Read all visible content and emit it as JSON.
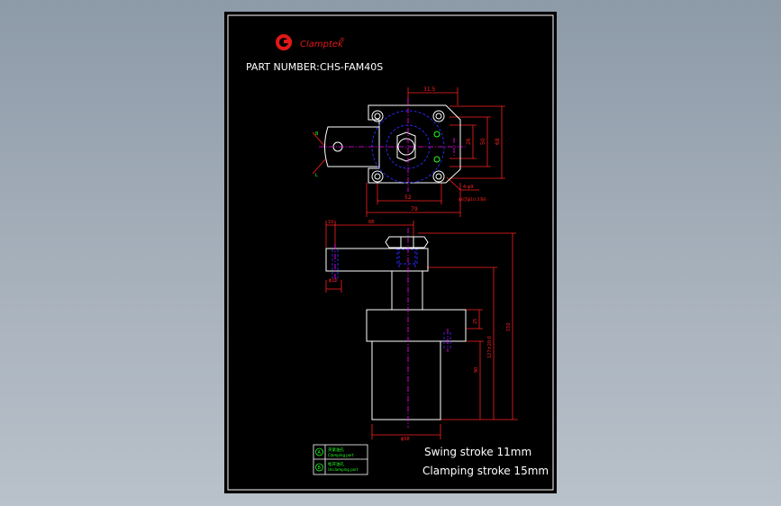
{
  "colors": {
    "background": "#000000",
    "outline": "#ffffff",
    "dimension": "#ff2020",
    "centerline": "#ff00ff",
    "hidden": "#2b2bff",
    "port_text": "#20ff20",
    "logo": "#e01818"
  },
  "title": {
    "brand": "Clamptek",
    "brand_mark": "®",
    "part_number_label": "PART NUMBER:",
    "part_number": "CHS-FAM40S"
  },
  "top_view": {
    "dims": {
      "overall_top": "31.5",
      "bottom_inner": "52",
      "bottom_overall": "79",
      "right_small": "26",
      "right_mid": "50",
      "right_large": "68"
    },
    "hole_note": "4-φ9",
    "thread_note": "ϕ6沉ϕ10.5深6",
    "side_markers": [
      "B",
      "L"
    ],
    "port_markers": [
      "A",
      "B"
    ]
  },
  "side_view": {
    "dims": {
      "top_left": "10",
      "top_arm": "68",
      "clamp_offset": "ϕ10",
      "right_small": "25",
      "right_mid": "127±20.0",
      "right_large": "150",
      "body_height": "90",
      "base_diameter": "ϕ58"
    }
  },
  "legend": {
    "items": [
      {
        "symbol": "A",
        "label": "夹紧油孔",
        "sublabel": "Clamping port"
      },
      {
        "symbol": "B",
        "label": "松开油孔",
        "sublabel": "Unclamping port"
      }
    ]
  },
  "specs": {
    "swing_stroke": "Swing stroke 11mm",
    "clamping_stroke": "Clamping stroke 15mm"
  }
}
